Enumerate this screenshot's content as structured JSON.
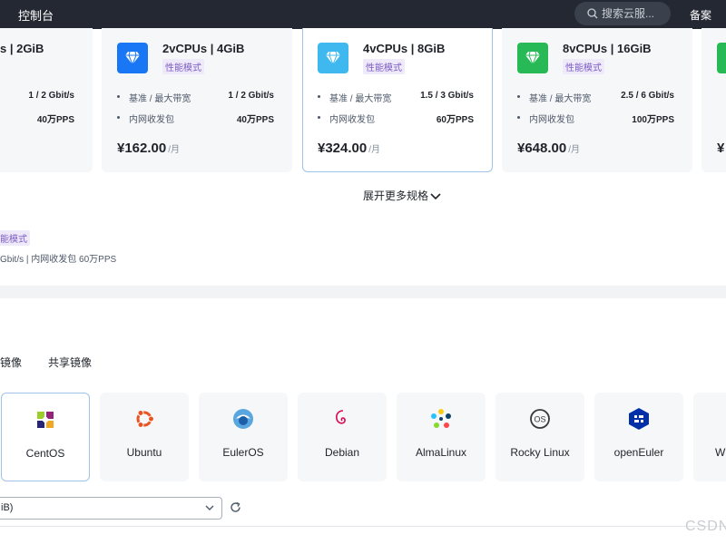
{
  "topbar": {
    "title": "控制台",
    "search_placeholder": "搜索云服...",
    "beian": "备案"
  },
  "spec_cards": [
    {
      "title": "s | 2GiB",
      "tag": "",
      "rows": [
        {
          "key": "",
          "value": "1 / 2 Gbit/s"
        },
        {
          "key": "",
          "value": "40万PPS"
        }
      ],
      "price": "",
      "unit": "",
      "color": "#1976f5"
    },
    {
      "title": "2vCPUs | 4GiB",
      "tag": "性能模式",
      "rows": [
        {
          "key": "基准 / 最大带宽",
          "value": "1 / 2 Gbit/s"
        },
        {
          "key": "内网收发包",
          "value": "40万PPS"
        }
      ],
      "price": "¥162.00",
      "unit": "/月",
      "color": "#1976f5"
    },
    {
      "title": "4vCPUs | 8GiB",
      "tag": "性能模式",
      "rows": [
        {
          "key": "基准 / 最大带宽",
          "value": "1.5 / 3 Gbit/s"
        },
        {
          "key": "内网收发包",
          "value": "60万PPS"
        }
      ],
      "price": "¥324.00",
      "unit": "/月",
      "color": "#3fb8f0"
    },
    {
      "title": "8vCPUs | 16GiB",
      "tag": "性能模式",
      "rows": [
        {
          "key": "基准 / 最大带宽",
          "value": "2.5 / 6 Gbit/s"
        },
        {
          "key": "内网收发包",
          "value": "100万PPS"
        }
      ],
      "price": "¥648.00",
      "unit": "/月",
      "color": "#26b955"
    },
    {
      "title": "",
      "tag": "",
      "rows": [
        {
          "key": "",
          "value": ""
        },
        {
          "key": "",
          "value": ""
        }
      ],
      "price": "¥",
      "unit": "",
      "color": "#26b955"
    }
  ],
  "expand_label": "展开更多规格",
  "selected_spec": {
    "tag": "能模式",
    "summary": "Gbit/s  |  内网收发包  60万PPS"
  },
  "image_tabs": [
    "镜像",
    "共享镜像"
  ],
  "os_list": [
    "CentOS",
    "Ubuntu",
    "EulerOS",
    "Debian",
    "AlmaLinux",
    "Rocky Linux",
    "openEuler",
    "W"
  ],
  "version_select": {
    "value": "iB)"
  },
  "watermark": "CSDN"
}
